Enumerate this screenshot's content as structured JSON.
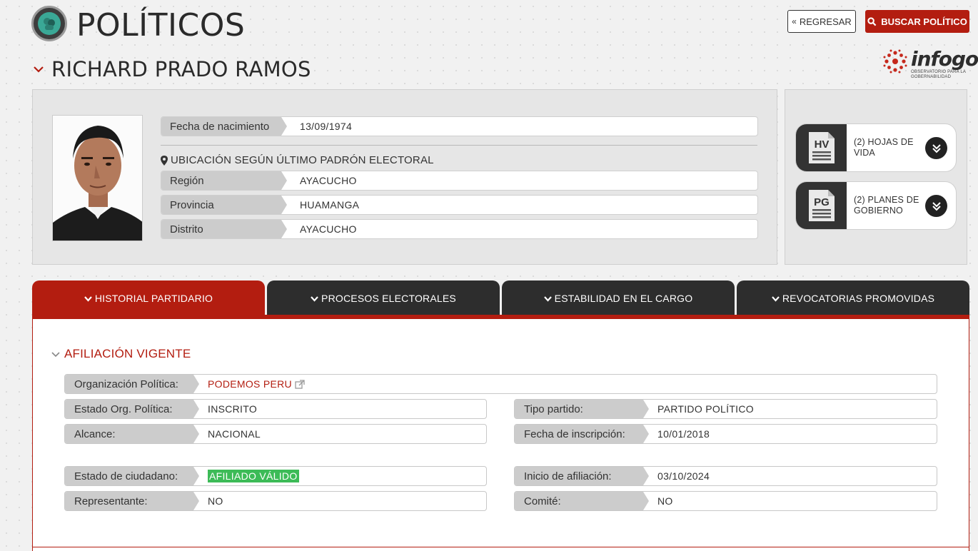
{
  "header": {
    "title": "POLÍTICOS",
    "back_label": "REGRESAR",
    "search_label": "BUSCAR POLÍTICO",
    "logo_word": "infogob",
    "logo_sub": "OBSERVATORIO PARA LA GOBERNABILIDAD"
  },
  "person": {
    "name": "RICHARD PRADO RAMOS",
    "birth_label": "Fecha de nacimiento",
    "birth_value": "13/09/1974",
    "location_heading": "UBICACIÓN SEGÚN ÚLTIMO PADRÓN ELECTORAL",
    "location": [
      {
        "label": "Región",
        "value": "AYACUCHO"
      },
      {
        "label": "Provincia",
        "value": "HUAMANGA"
      },
      {
        "label": "Distrito",
        "value": "AYACUCHO"
      }
    ]
  },
  "documents": [
    {
      "icon": "HV",
      "label": "(2) HOJAS DE VIDA"
    },
    {
      "icon": "PG",
      "label": "(2) PLANES DE GOBIERNO"
    }
  ],
  "tabs": [
    {
      "label": "HISTORIAL PARTIDARIO",
      "active": true
    },
    {
      "label": "PROCESOS ELECTORALES",
      "active": false
    },
    {
      "label": "ESTABILIDAD EN EL CARGO",
      "active": false
    },
    {
      "label": "REVOCATORIAS PROMOVIDAS",
      "active": false
    }
  ],
  "affiliation": {
    "title": "AFILIACIÓN VIGENTE",
    "org_label": "Organización Política:",
    "org_value": "PODEMOS PERU",
    "estado_org_label": "Estado Org. Política:",
    "estado_org_value": "INSCRITO",
    "tipo_label": "Tipo partido:",
    "tipo_value": "PARTIDO POLÍTICO",
    "alcance_label": "Alcance:",
    "alcance_value": "NACIONAL",
    "fecha_insc_label": "Fecha de inscripción:",
    "fecha_insc_value": "10/01/2018",
    "estado_ciud_label": "Estado de ciudadano:",
    "estado_ciud_value": "AFILIADO VÁLIDO",
    "inicio_label": "Inicio de afiliación:",
    "inicio_value": "03/10/2024",
    "repr_label": "Representante:",
    "repr_value": "NO",
    "comite_label": "Comité:",
    "comite_value": "NO"
  },
  "colors": {
    "accent": "#b31d10",
    "dark": "#2d2d2d",
    "badge": "#3cbb57"
  }
}
